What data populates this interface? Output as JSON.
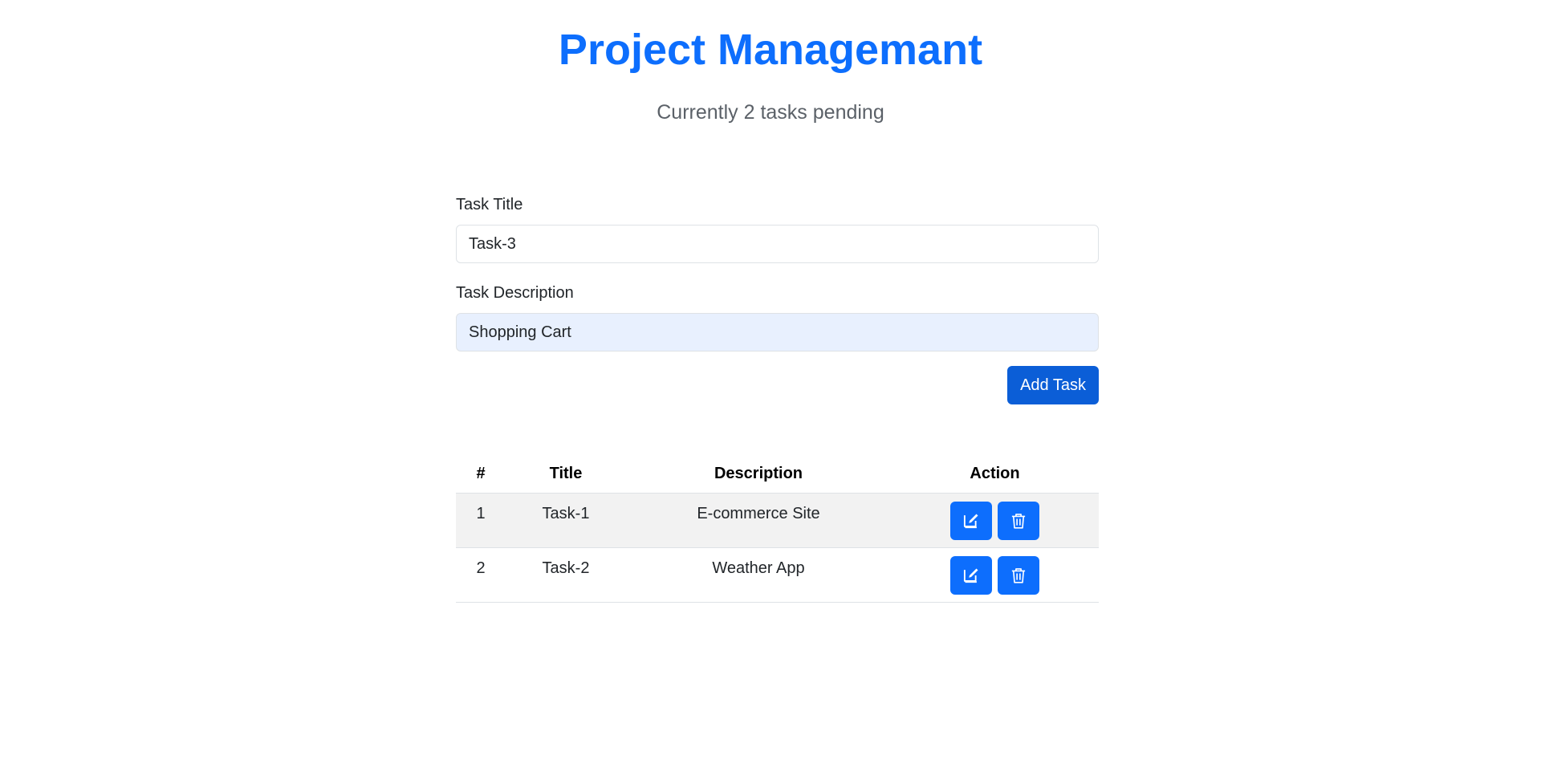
{
  "header": {
    "title": "Project Managemant",
    "subtitle": "Currently 2 tasks pending"
  },
  "form": {
    "title_label": "Task Title",
    "title_value": "Task-3",
    "description_label": "Task Description",
    "description_value": "Shopping Cart",
    "add_button_label": "Add Task"
  },
  "table": {
    "headers": [
      "#",
      "Title",
      "Description",
      "Action"
    ],
    "rows": [
      {
        "num": "1",
        "title": "Task-1",
        "description": "E-commerce Site"
      },
      {
        "num": "2",
        "title": "Task-2",
        "description": "Weather App"
      }
    ],
    "edit_icon": "edit-icon",
    "delete_icon": "trash-icon"
  },
  "colors": {
    "accent": "#0d6efd",
    "button_dark": "#0b5ed7",
    "input_autofill": "#e8f0fe",
    "row_stripe": "#f2f2f2"
  }
}
